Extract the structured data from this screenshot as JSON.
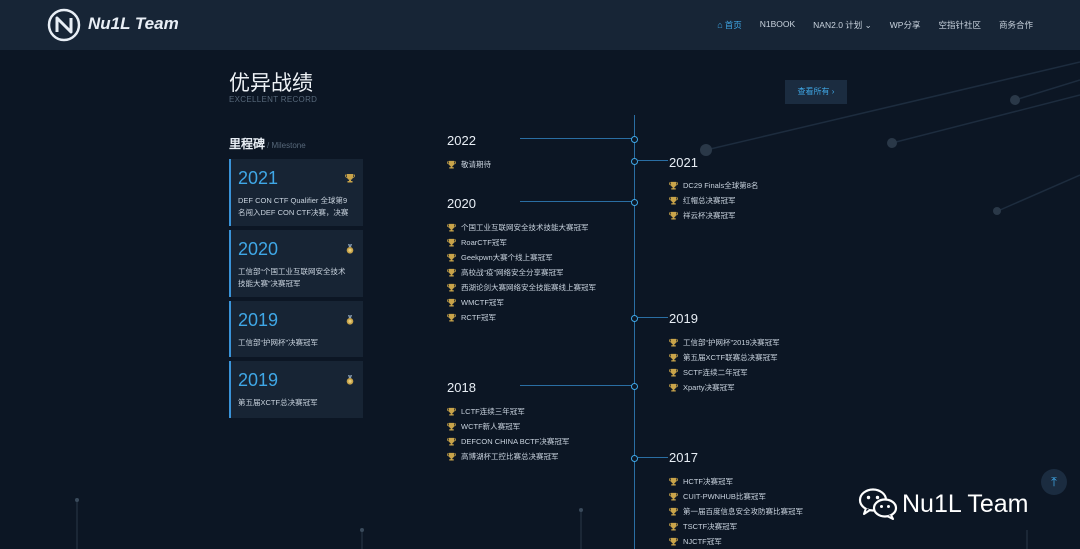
{
  "navbar": {
    "brand": "Nu1L Team",
    "items": [
      {
        "label": "首页",
        "active": true
      },
      {
        "label": "N1BOOK"
      },
      {
        "label": "NAN2.0 计划 ⌄"
      },
      {
        "label": "WP分享"
      },
      {
        "label": "空指针社区"
      },
      {
        "label": "商务合作"
      }
    ]
  },
  "section": {
    "title": "优异战绩",
    "subtitle": "EXCELLENT RECORD",
    "view_all": "查看所有 ›"
  },
  "milestone": {
    "title": "里程碑",
    "subtitle": "/ Milestone",
    "cards": [
      {
        "year": "2021",
        "desc": "DEF CON CTF Qualifier 全球第9名闯入DEF CON CTF决赛，决赛第..."
      },
      {
        "year": "2020",
        "desc": "工信部“个国工业互联网安全技术技能大赛”决赛冠军"
      },
      {
        "year": "2019",
        "desc": "工信部“护网杯”决赛冠军"
      },
      {
        "year": "2019",
        "desc": "第五届XCTF总决赛冠军"
      }
    ]
  },
  "timeline": {
    "left": [
      {
        "year": "2022",
        "items": [
          "敬请期待"
        ]
      },
      {
        "year": "2020",
        "items": [
          "个国工业互联网安全技术技能大赛冠军",
          "RoarCTF冠军",
          "Geekpwn大赛个线上赛冠军",
          "高校战“疫”网络安全分享赛冠军",
          "西湖论剑大赛网络安全技能赛线上赛冠军",
          "WMCTF冠军",
          "RCTF冠军"
        ]
      },
      {
        "year": "2018",
        "items": [
          "LCTF连续三年冠军",
          "WCTF新人赛冠军",
          "DEFCON CHINA BCTF决赛冠军",
          "高博湖杯工控比赛总决赛冠军"
        ]
      }
    ],
    "right": [
      {
        "year": "2021",
        "items": [
          "DC29 Finals全球第8名",
          "红帽总决赛冠军",
          "祥云杯决赛冠军"
        ]
      },
      {
        "year": "2019",
        "items": [
          "工信部“护网杯”2019决赛冠军",
          "第五届XCTF联赛总决赛冠军",
          "SCTF连续二年冠军",
          "Xparty决赛冠军"
        ]
      },
      {
        "year": "2017",
        "items": [
          "HCTF决赛冠军",
          "CUIT-PWNHUB比赛冠军",
          "第一届百度信息安全攻防赛比赛冠军",
          "TSCTF决赛冠军",
          "NJCTF冠军"
        ]
      }
    ]
  },
  "watermark": {
    "text": "Nu1L Team"
  },
  "scroll_top": {
    "label": "⤒"
  }
}
